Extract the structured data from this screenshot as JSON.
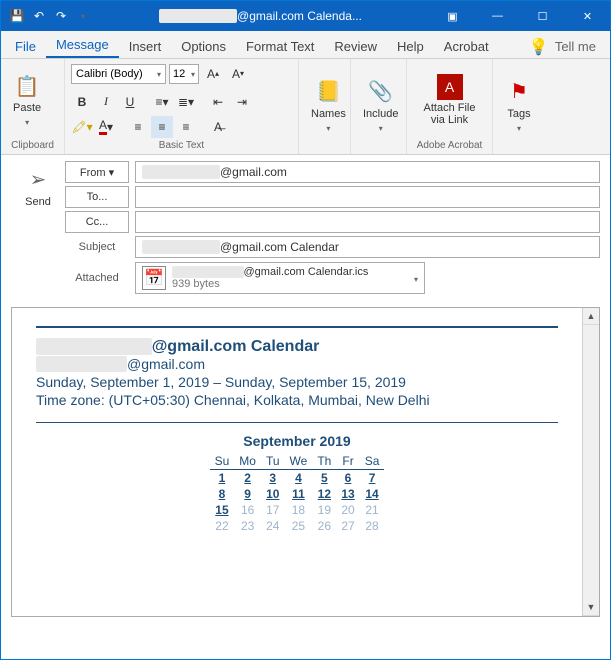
{
  "titlebar": {
    "title": "@gmail.com Calenda..."
  },
  "tabs": {
    "file": "File",
    "message": "Message",
    "insert": "Insert",
    "options": "Options",
    "format": "Format Text",
    "review": "Review",
    "help": "Help",
    "acrobat": "Acrobat",
    "tellme": "Tell me"
  },
  "ribbon": {
    "paste": "Paste",
    "clipboard_label": "Clipboard",
    "font_name": "Calibri (Body)",
    "font_size": "12",
    "basictext_label": "Basic Text",
    "names": "Names",
    "include": "Include",
    "attachfile": "Attach File via Link",
    "acrobat_label": "Adobe Acrobat",
    "tags": "Tags"
  },
  "compose": {
    "send": "Send",
    "from_btn": "From ▾",
    "from_val": "@gmail.com",
    "to_btn": "To...",
    "cc_btn": "Cc...",
    "subject_label": "Subject",
    "subject_val": "@gmail.com Calendar",
    "attached_label": "Attached",
    "attach_name": "@gmail.com Calendar.ics",
    "attach_size": "939 bytes"
  },
  "body": {
    "title": "@gmail.com Calendar",
    "email": "@gmail.com",
    "range": "Sunday, September 1, 2019 – Sunday, September 15, 2019",
    "timezone": "Time zone: (UTC+05:30) Chennai, Kolkata, Mumbai, New Delhi",
    "month": "September 2019",
    "dow": [
      "Su",
      "Mo",
      "Tu",
      "We",
      "Th",
      "Fr",
      "Sa"
    ],
    "weeks": [
      [
        {
          "v": "1",
          "l": true
        },
        {
          "v": "2",
          "l": true
        },
        {
          "v": "3",
          "l": true
        },
        {
          "v": "4",
          "l": true
        },
        {
          "v": "5",
          "l": true
        },
        {
          "v": "6",
          "l": true
        },
        {
          "v": "7",
          "l": true
        }
      ],
      [
        {
          "v": "8",
          "l": true
        },
        {
          "v": "9",
          "l": true
        },
        {
          "v": "10",
          "l": true
        },
        {
          "v": "11",
          "l": true
        },
        {
          "v": "12",
          "l": true
        },
        {
          "v": "13",
          "l": true
        },
        {
          "v": "14",
          "l": true
        }
      ],
      [
        {
          "v": "15",
          "l": true
        },
        {
          "v": "16",
          "f": true
        },
        {
          "v": "17",
          "f": true
        },
        {
          "v": "18",
          "f": true
        },
        {
          "v": "19",
          "f": true
        },
        {
          "v": "20",
          "f": true
        },
        {
          "v": "21",
          "f": true
        }
      ],
      [
        {
          "v": "22",
          "f": true
        },
        {
          "v": "23",
          "f": true
        },
        {
          "v": "24",
          "f": true
        },
        {
          "v": "25",
          "f": true
        },
        {
          "v": "26",
          "f": true
        },
        {
          "v": "27",
          "f": true
        },
        {
          "v": "28",
          "f": true
        }
      ]
    ]
  }
}
